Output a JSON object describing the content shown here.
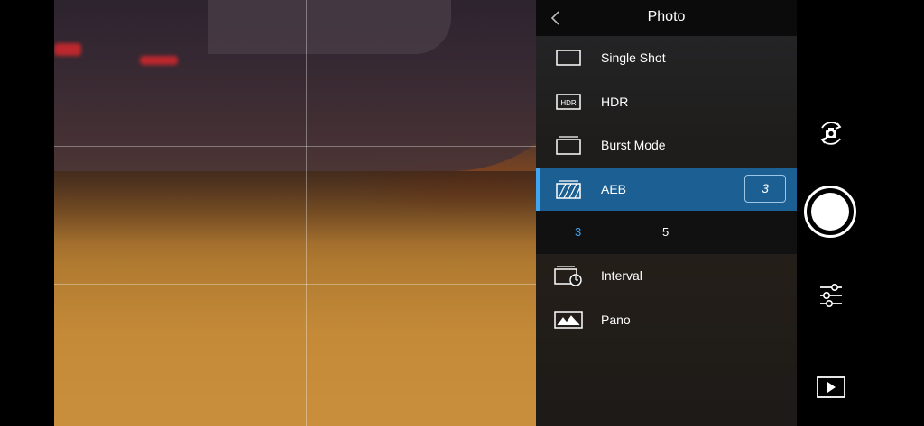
{
  "panel": {
    "title": "Photo"
  },
  "menu": {
    "items": [
      {
        "label": "Single Shot",
        "icon": "single-shot-icon"
      },
      {
        "label": "HDR",
        "icon": "hdr-icon"
      },
      {
        "label": "Burst Mode",
        "icon": "burst-mode-icon"
      },
      {
        "label": "AEB",
        "icon": "aeb-icon",
        "selected": true
      },
      {
        "label": "Interval",
        "icon": "interval-icon"
      },
      {
        "label": "Pano",
        "icon": "pano-icon"
      }
    ],
    "hdr_icon_text": "HDR",
    "aeb_value": "3",
    "aeb_options": [
      "3",
      "5"
    ],
    "aeb_selected_option": "3"
  },
  "controls": {
    "icons": [
      "switch-camera-icon",
      "shutter-button",
      "settings-sliders-icon",
      "playback-icon"
    ]
  },
  "colors": {
    "accent": "#3ea6f2",
    "selected_row": "#1c5f93",
    "panel_bg": "#121212"
  }
}
